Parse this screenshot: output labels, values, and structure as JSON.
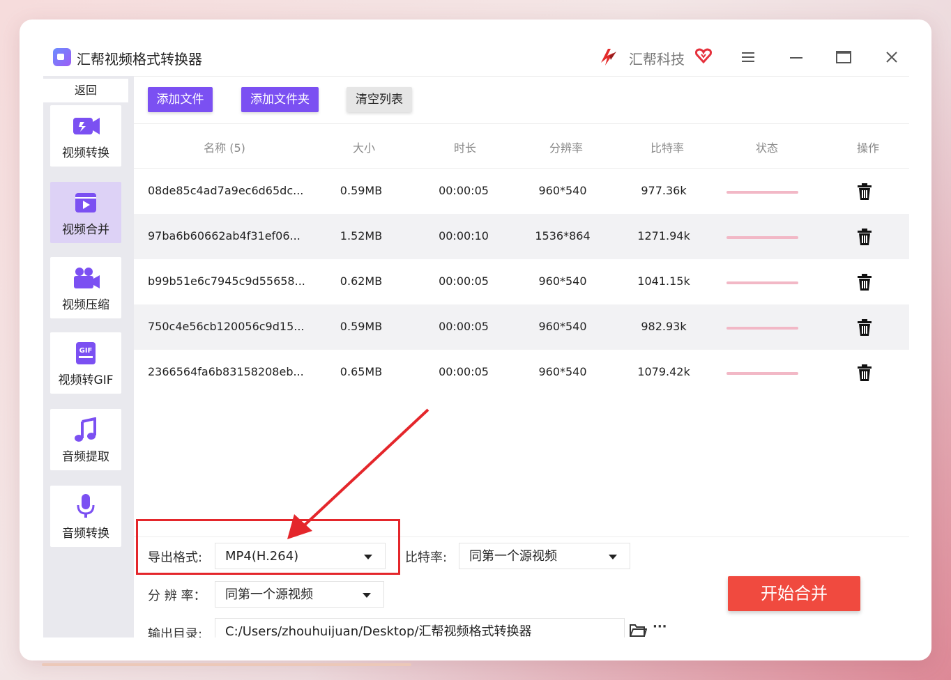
{
  "window": {
    "title": "汇帮视频格式转换器",
    "brand": "汇帮科技",
    "accent_color": "#7b50f2",
    "start_color": "#f04a3f"
  },
  "sidebar": {
    "back_label": "返回",
    "items": [
      {
        "label": "视频转换",
        "icon": "video-convert-icon",
        "active": false
      },
      {
        "label": "视频合并",
        "icon": "video-merge-icon",
        "active": true
      },
      {
        "label": "视频压缩",
        "icon": "video-compress-icon",
        "active": false
      },
      {
        "label": "视频转GIF",
        "icon": "gif-icon",
        "active": false
      },
      {
        "label": "音频提取",
        "icon": "music-note-icon",
        "active": false
      },
      {
        "label": "音频转换",
        "icon": "microphone-icon",
        "active": false
      }
    ]
  },
  "toolbar": {
    "add_file": "添加文件",
    "add_folder": "添加文件夹",
    "clear_list": "清空列表"
  },
  "table": {
    "headers": {
      "name": "名称 (5)",
      "size": "大小",
      "duration": "时长",
      "resolution": "分辨率",
      "bitrate": "比特率",
      "status": "状态",
      "action": "操作"
    },
    "rows": [
      {
        "name": "08de85c4ad7a9ec6d65dc...",
        "size": "0.59MB",
        "duration": "00:00:05",
        "resolution": "960*540",
        "bitrate": "977.36k"
      },
      {
        "name": "97ba6b60662ab4f31ef06...",
        "size": "1.52MB",
        "duration": "00:00:10",
        "resolution": "1536*864",
        "bitrate": "1271.94k"
      },
      {
        "name": "b99b51e6c7945c9d55658...",
        "size": "0.62MB",
        "duration": "00:00:05",
        "resolution": "960*540",
        "bitrate": "1041.15k"
      },
      {
        "name": "750c4e56cb120056c9d15...",
        "size": "0.59MB",
        "duration": "00:00:05",
        "resolution": "960*540",
        "bitrate": "982.93k"
      },
      {
        "name": "2366564fa6b83158208eb...",
        "size": "0.65MB",
        "duration": "00:00:05",
        "resolution": "960*540",
        "bitrate": "1079.42k"
      }
    ]
  },
  "settings": {
    "format_label": "导出格式:",
    "format_value": "MP4(H.264)",
    "bitrate_label": "比特率:",
    "bitrate_value": "同第一个源视频",
    "resolution_label": "分 辨 率：",
    "resolution_value": "同第一个源视频",
    "output_label": "输出目录:",
    "output_value": "C:/Users/zhouhuijuan/Desktop/汇帮视频格式转换器",
    "more": "···",
    "start": "开始合并"
  }
}
